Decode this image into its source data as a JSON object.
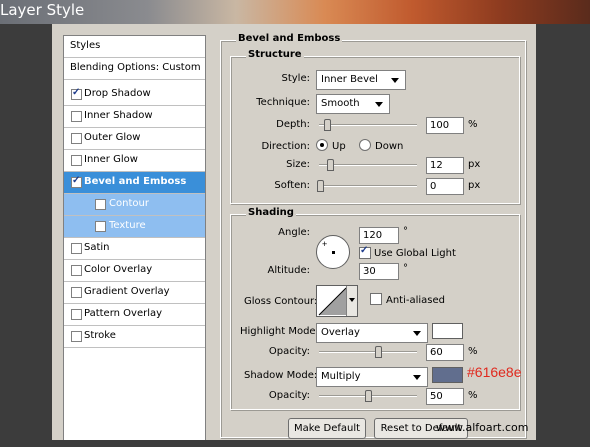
{
  "window": {
    "title": "Layer Style"
  },
  "styles_list": {
    "header": "Styles",
    "blending": "Blending Options: Custom",
    "items": [
      {
        "label": "Drop Shadow",
        "checked": true
      },
      {
        "label": "Inner Shadow",
        "checked": false
      },
      {
        "label": "Outer Glow",
        "checked": false
      },
      {
        "label": "Inner Glow",
        "checked": false
      },
      {
        "label": "Bevel and Emboss",
        "checked": true,
        "selected": true
      },
      {
        "label": "Contour",
        "checked": false,
        "sub": true
      },
      {
        "label": "Texture",
        "checked": false,
        "sub": true
      },
      {
        "label": "Satin",
        "checked": false
      },
      {
        "label": "Color Overlay",
        "checked": false
      },
      {
        "label": "Gradient Overlay",
        "checked": false
      },
      {
        "label": "Pattern Overlay",
        "checked": false
      },
      {
        "label": "Stroke",
        "checked": false
      }
    ]
  },
  "bevel": {
    "title": "Bevel and Emboss",
    "structure": {
      "title": "Structure",
      "style_label": "Style:",
      "style_value": "Inner Bevel",
      "technique_label": "Technique:",
      "technique_value": "Smooth",
      "depth_label": "Depth:",
      "depth_value": "100",
      "depth_unit": "%",
      "direction_label": "Direction:",
      "dir_up": "Up",
      "dir_down": "Down",
      "size_label": "Size:",
      "size_value": "12",
      "size_unit": "px",
      "soften_label": "Soften:",
      "soften_value": "0",
      "soften_unit": "px"
    },
    "shading": {
      "title": "Shading",
      "angle_label": "Angle:",
      "angle_value": "120",
      "angle_unit": "°",
      "global_light": "Use Global Light",
      "altitude_label": "Altitude:",
      "altitude_value": "30",
      "altitude_unit": "°",
      "gloss_label": "Gloss Contour:",
      "anti_aliased": "Anti-aliased",
      "highlight_label": "Highlight Mode:",
      "highlight_value": "Overlay",
      "highlight_color": "#ffffff",
      "opacity_label": "Opacity:",
      "highlight_opacity": "60",
      "opacity_unit": "%",
      "shadow_label": "Shadow Mode:",
      "shadow_value": "Multiply",
      "shadow_color": "#616e8e",
      "shadow_color_note": "#616e8e",
      "shadow_opacity": "50"
    },
    "buttons": {
      "make_default": "Make Default",
      "reset_default": "Reset to Default"
    }
  },
  "watermark": "www.alfoart.com"
}
